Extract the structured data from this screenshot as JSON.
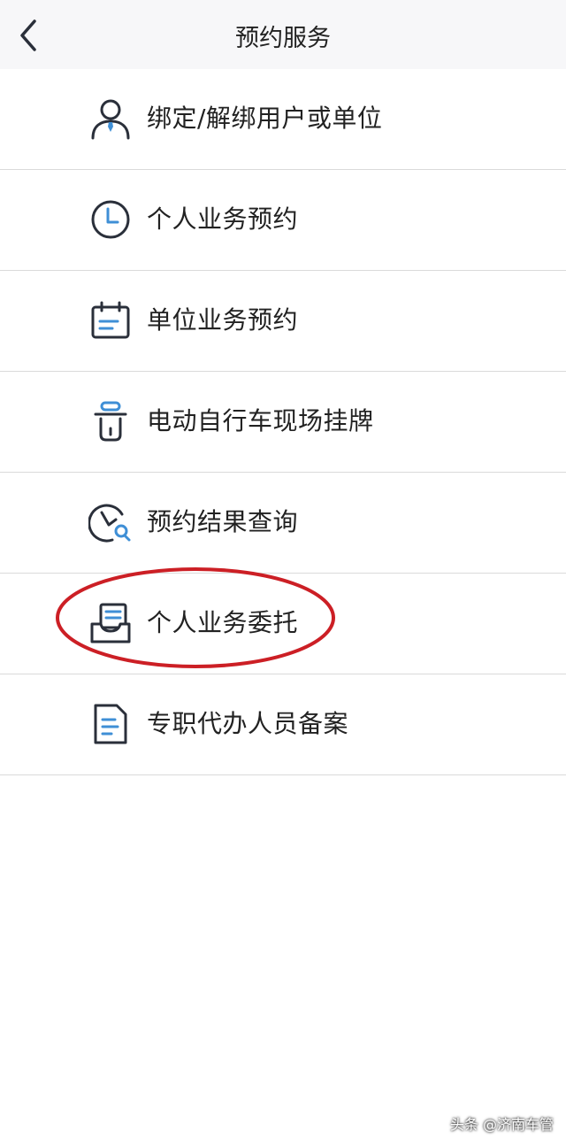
{
  "header": {
    "title": "预约服务",
    "back_icon": "chevron-left-icon"
  },
  "menu": {
    "items": [
      {
        "label": "绑定/解绑用户或单位",
        "icon": "user-tie-icon"
      },
      {
        "label": "个人业务预约",
        "icon": "clock-icon"
      },
      {
        "label": "单位业务预约",
        "icon": "calendar-icon"
      },
      {
        "label": "电动自行车现场挂牌",
        "icon": "scooter-icon"
      },
      {
        "label": "预约结果查询",
        "icon": "clock-search-icon"
      },
      {
        "label": "个人业务委托",
        "icon": "inbox-documents-icon",
        "highlighted": true
      },
      {
        "label": "专职代办人员备案",
        "icon": "document-icon"
      }
    ]
  },
  "annotation": {
    "ring_color": "#cc1f25"
  },
  "watermark": {
    "text": "头条 @济南车管"
  },
  "colors": {
    "icon_stroke": "#2a2f3a",
    "icon_accent": "#3f8fd6",
    "divider": "#dadada",
    "header_bg": "#f7f7f9"
  }
}
